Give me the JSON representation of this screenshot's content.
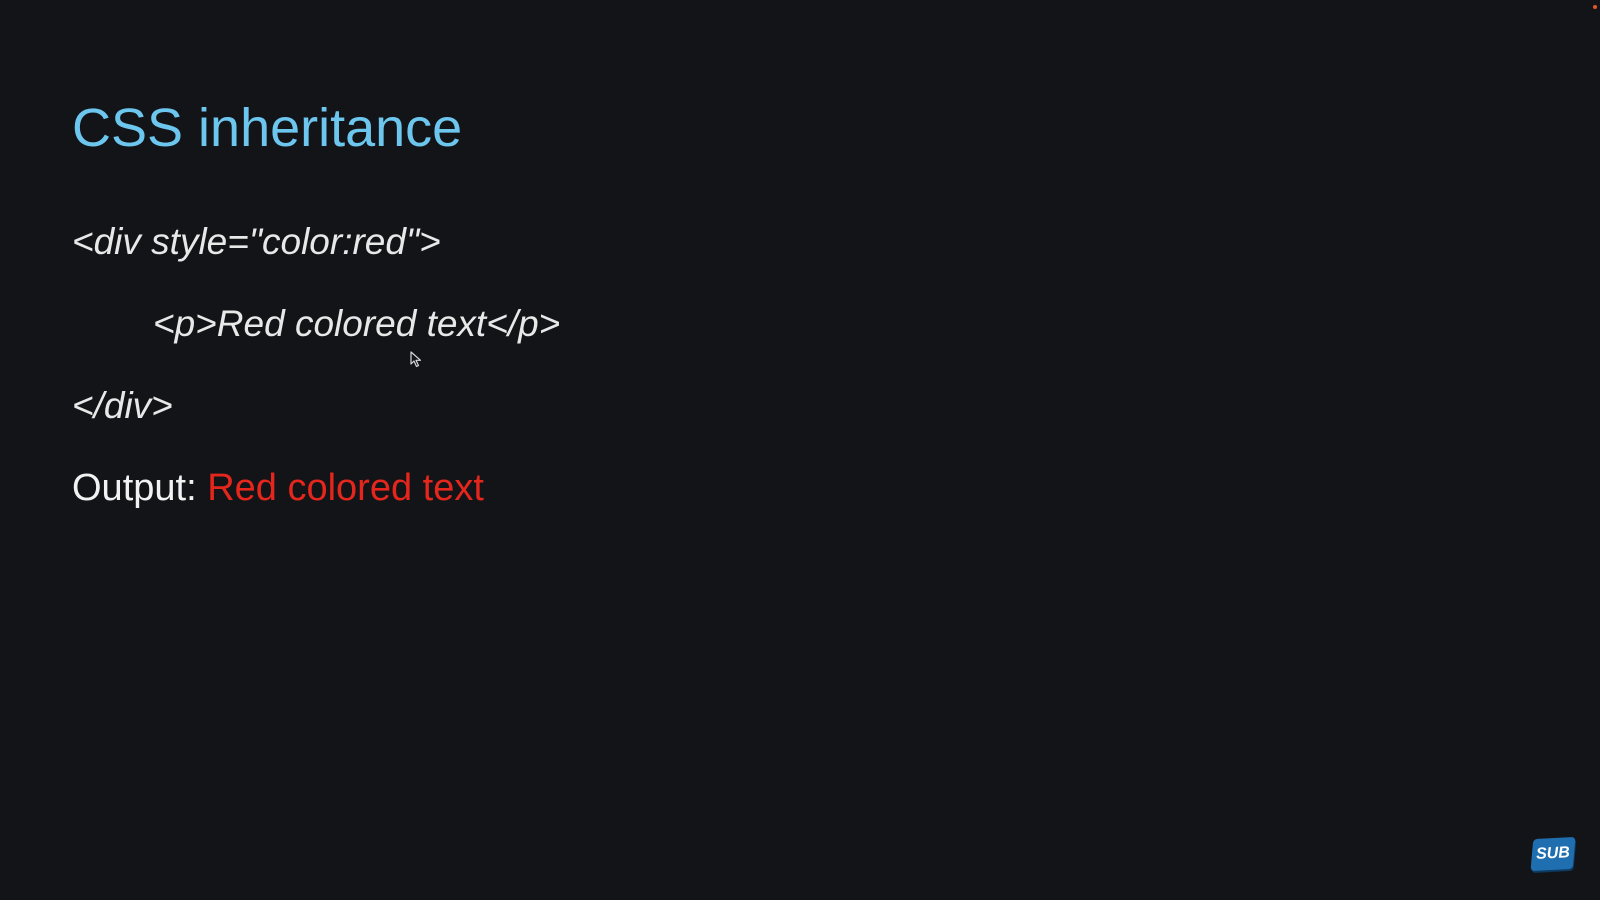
{
  "slide": {
    "title": "CSS inheritance",
    "code_lines": [
      "<div style=\"color:red\">",
      "<p>Red colored text</p>",
      "</div>"
    ],
    "output_label": "Output:",
    "output_value": "Red colored text"
  },
  "colors": {
    "background": "#131418",
    "title": "#6cc6ee",
    "code_text": "#e8e8e8",
    "output_value": "#e4261c",
    "badge": "#1f6fb0"
  },
  "overlay": {
    "badge_label": "SUB",
    "badge_icon": "subscribe-badge-icon",
    "cursor_icon": "mouse-pointer-icon"
  }
}
